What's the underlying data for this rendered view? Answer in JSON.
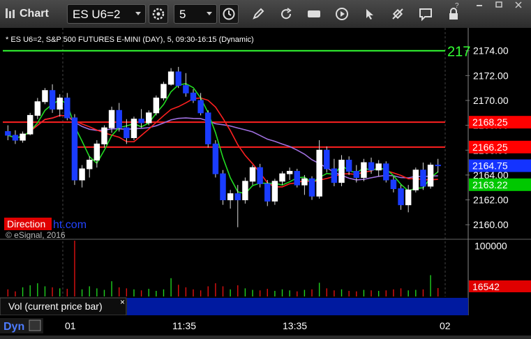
{
  "app": {
    "title": "Chart"
  },
  "toolbar": {
    "symbol": "ES U6=2",
    "interval": "5"
  },
  "chart_data": {
    "type": "candlestick",
    "title": "* ES U6=2, S&P 500 FUTURES E-MINI (DAY), 5, 09:30-16:15 (Dynamic)",
    "copyright": "© eSignal, 2016",
    "watermark": {
      "left": "Direction",
      "right": "ht.com"
    },
    "price_axis": {
      "ylim": [
        2159,
        2175.5
      ],
      "ticks": [
        2160,
        2162,
        2164,
        2166,
        2168,
        2170,
        2172,
        2174
      ],
      "tick_labels": [
        "2160.00",
        "2162.00",
        "2164.00",
        "2166.00",
        "2168.00",
        "2170.00",
        "2172.00",
        "2174.00"
      ]
    },
    "price_labels": [
      {
        "value": 2168.25,
        "text": "2168.25",
        "color": "#ff0000"
      },
      {
        "value": 2166.25,
        "text": "2166.25",
        "color": "#ff0000"
      },
      {
        "value": 2164.75,
        "text": "2164.75",
        "color": "#1433ff"
      },
      {
        "value": 2163.22,
        "text": "2163.22",
        "color": "#00c800"
      }
    ],
    "level_lines": [
      {
        "value": 2174.0,
        "color": "#33ff33",
        "from": 0.0,
        "to": 1.0,
        "text": "217"
      },
      {
        "value": 2168.25,
        "color": "#ff2020",
        "from": 0.0,
        "to": 1.0
      },
      {
        "value": 2166.25,
        "color": "#ff2020",
        "from": 0.15,
        "to": 1.0
      }
    ],
    "x_labels": [
      "01",
      "11:35",
      "13:35",
      "02"
    ],
    "candles": [
      [
        2167.5,
        2168.0,
        2166.8,
        2167.2
      ],
      [
        2167.2,
        2167.6,
        2166.5,
        2166.8
      ],
      [
        2166.8,
        2167.5,
        2166.6,
        2167.3
      ],
      [
        2167.3,
        2169.0,
        2167.2,
        2168.8
      ],
      [
        2168.8,
        2170.2,
        2168.5,
        2169.9
      ],
      [
        2169.9,
        2171.0,
        2169.7,
        2170.8
      ],
      [
        2170.8,
        2171.3,
        2169.0,
        2169.3
      ],
      [
        2169.3,
        2170.5,
        2168.7,
        2170.2
      ],
      [
        2170.2,
        2170.6,
        2168.4,
        2168.6
      ],
      [
        2168.6,
        2168.9,
        2163.2,
        2163.6
      ],
      [
        2163.6,
        2164.8,
        2163.0,
        2164.5
      ],
      [
        2164.5,
        2165.5,
        2163.8,
        2165.2
      ],
      [
        2165.2,
        2166.8,
        2164.6,
        2166.5
      ],
      [
        2166.5,
        2168.0,
        2166.2,
        2167.8
      ],
      [
        2167.8,
        2169.5,
        2167.4,
        2169.2
      ],
      [
        2169.2,
        2169.8,
        2167.5,
        2167.8
      ],
      [
        2167.8,
        2168.5,
        2166.5,
        2167.0
      ],
      [
        2167.0,
        2168.7,
        2166.8,
        2168.5
      ],
      [
        2168.5,
        2169.3,
        2167.8,
        2168.2
      ],
      [
        2168.2,
        2169.2,
        2168.0,
        2169.0
      ],
      [
        2169.0,
        2170.4,
        2168.8,
        2170.2
      ],
      [
        2170.2,
        2171.5,
        2170.0,
        2171.3
      ],
      [
        2171.3,
        2172.6,
        2171.2,
        2172.3
      ],
      [
        2172.3,
        2172.7,
        2171.0,
        2171.2
      ],
      [
        2171.2,
        2172.2,
        2170.3,
        2170.6
      ],
      [
        2170.6,
        2170.9,
        2169.8,
        2170.0
      ],
      [
        2170.0,
        2170.6,
        2168.8,
        2169.0
      ],
      [
        2169.0,
        2169.2,
        2166.2,
        2166.5
      ],
      [
        2166.5,
        2166.8,
        2163.8,
        2164.1
      ],
      [
        2164.1,
        2164.4,
        2161.6,
        2162.0
      ],
      [
        2162.0,
        2162.8,
        2161.3,
        2162.5
      ],
      [
        2162.5,
        2163.2,
        2159.8,
        2162.0
      ],
      [
        2162.0,
        2163.8,
        2161.7,
        2163.5
      ],
      [
        2163.5,
        2164.8,
        2163.2,
        2164.6
      ],
      [
        2164.6,
        2164.9,
        2163.0,
        2163.3
      ],
      [
        2163.3,
        2163.6,
        2161.5,
        2161.9
      ],
      [
        2161.9,
        2163.7,
        2161.6,
        2163.5
      ],
      [
        2163.5,
        2164.3,
        2163.2,
        2164.1
      ],
      [
        2164.1,
        2164.6,
        2163.6,
        2164.3
      ],
      [
        2164.3,
        2164.5,
        2163.0,
        2163.2
      ],
      [
        2163.2,
        2164.0,
        2162.4,
        2163.7
      ],
      [
        2163.7,
        2163.9,
        2162.0,
        2162.3
      ],
      [
        2162.3,
        2166.8,
        2162.1,
        2166.0
      ],
      [
        2166.0,
        2166.3,
        2164.2,
        2164.5
      ],
      [
        2164.5,
        2165.3,
        2163.1,
        2163.4
      ],
      [
        2163.4,
        2165.6,
        2163.1,
        2165.2
      ],
      [
        2165.2,
        2165.5,
        2164.0,
        2164.3
      ],
      [
        2164.3,
        2164.8,
        2163.4,
        2163.8
      ],
      [
        2163.8,
        2165.3,
        2163.5,
        2165.0
      ],
      [
        2165.0,
        2165.4,
        2164.1,
        2164.4
      ],
      [
        2164.4,
        2165.2,
        2163.9,
        2164.9
      ],
      [
        2164.9,
        2165.1,
        2163.4,
        2163.6
      ],
      [
        2163.6,
        2163.9,
        2162.6,
        2162.9
      ],
      [
        2162.9,
        2163.2,
        2161.2,
        2161.6
      ],
      [
        2161.6,
        2163.2,
        2161.0,
        2162.8
      ],
      [
        2162.8,
        2164.6,
        2162.6,
        2164.4
      ],
      [
        2164.4,
        2165.0,
        2162.8,
        2163.1
      ],
      [
        2163.1,
        2165.0,
        2162.9,
        2164.8
      ],
      [
        2164.8,
        2165.3,
        2164.2,
        2164.75
      ]
    ],
    "volume": {
      "ylim": [
        0,
        110000
      ],
      "ticks": [
        100000
      ],
      "tick_labels": [
        "100000"
      ],
      "current_label": "16542",
      "legend": "Vol (current price bar)",
      "values": [
        14000,
        10000,
        18000,
        22000,
        26000,
        20000,
        18000,
        16000,
        15000,
        110000,
        14000,
        20000,
        16000,
        13000,
        30000,
        18000,
        16000,
        14000,
        12000,
        15000,
        11000,
        14000,
        36000,
        23000,
        18000,
        14000,
        12000,
        20000,
        26000,
        20000,
        14000,
        22000,
        16000,
        13000,
        12000,
        15000,
        11000,
        14000,
        12000,
        10000,
        13000,
        14000,
        27000,
        16000,
        12000,
        14000,
        11000,
        10000,
        13000,
        12000,
        11000,
        12000,
        14000,
        16000,
        12000,
        13000,
        14000,
        42000,
        16542
      ]
    }
  },
  "bottom": {
    "label": "Dyn"
  }
}
